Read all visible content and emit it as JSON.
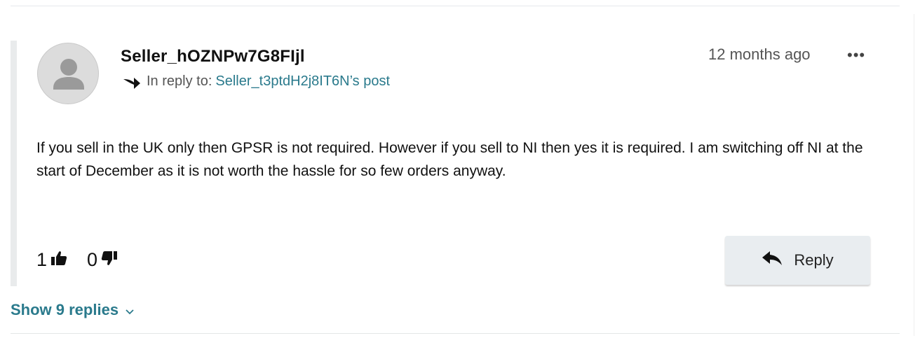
{
  "post": {
    "author": "Seller_hOZNPw7G8FIjl",
    "reply_prefix": "In reply to:",
    "reply_target": "Seller_t3ptdH2j8IT6N’s post",
    "timestamp": "12 months ago",
    "more_label": "•••",
    "body": "If you sell in the UK only then GPSR is not required. However if you sell to NI then yes it is required. I am switching off NI at the start of December as it is not worth the hassle for so few orders anyway.",
    "upvotes": "1",
    "downvotes": "0",
    "reply_label": "Reply"
  },
  "thread": {
    "show_replies_label": "Show 9 replies"
  },
  "icons": {
    "avatar": "default-user-avatar-icon",
    "reply_arrow": "reply-arrow-icon",
    "thumbs_up": "thumbs-up-icon",
    "thumbs_down": "thumbs-down-icon",
    "reply_button": "reply-icon",
    "chevron": "chevron-down-icon",
    "more": "more-options-icon"
  },
  "colors": {
    "link": "#2a7a8c",
    "button_bg": "#e9edf0",
    "rule": "#e9ebec"
  }
}
